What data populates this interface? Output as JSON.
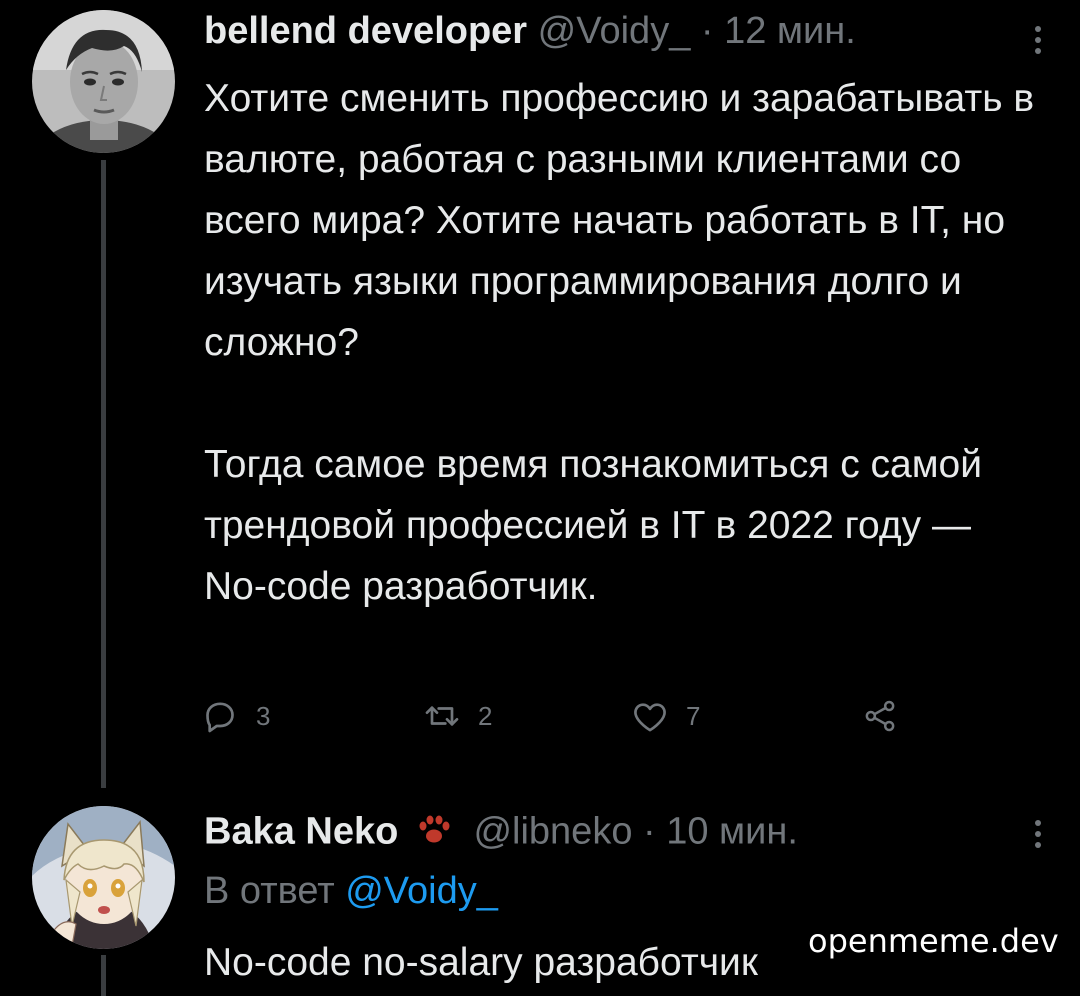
{
  "tweets": [
    {
      "author_name": "bellend developer",
      "handle": "@Voidy_",
      "separator": "·",
      "time": "12 мин.",
      "avatar_icon": "avatar-photo",
      "paragraphs": [
        "Хотите сменить профессию и зарабатывать в валюте, работая с разными клиентами со всего мира? Хотите начать работать в IT, но изучать языки программирования долго и сложно?",
        "Тогда самое время познакомиться с самой трендовой профессией в IT в 2022 году — No-code разработчик."
      ],
      "actions": {
        "reply_count": "3",
        "retweet_count": "2",
        "like_count": "7",
        "reply_icon": "reply-icon",
        "retweet_icon": "retweet-icon",
        "like_icon": "heart-icon",
        "share_icon": "share-icon"
      }
    },
    {
      "author_name": "Baka Neko",
      "badge_icon": "paw-print-icon",
      "handle": "@libneko",
      "separator": "·",
      "time": "10 мин.",
      "avatar_icon": "anime-avatar",
      "reply_prefix": "В ответ",
      "reply_mention": "@Voidy_",
      "text": "No-code no-salary разработчик"
    }
  ],
  "watermark": "openmeme.dev",
  "colors": {
    "background": "#000000",
    "text": "#e7e9ea",
    "secondary": "#71767b",
    "link": "#1d9bf0",
    "paw": "#c0392b"
  }
}
